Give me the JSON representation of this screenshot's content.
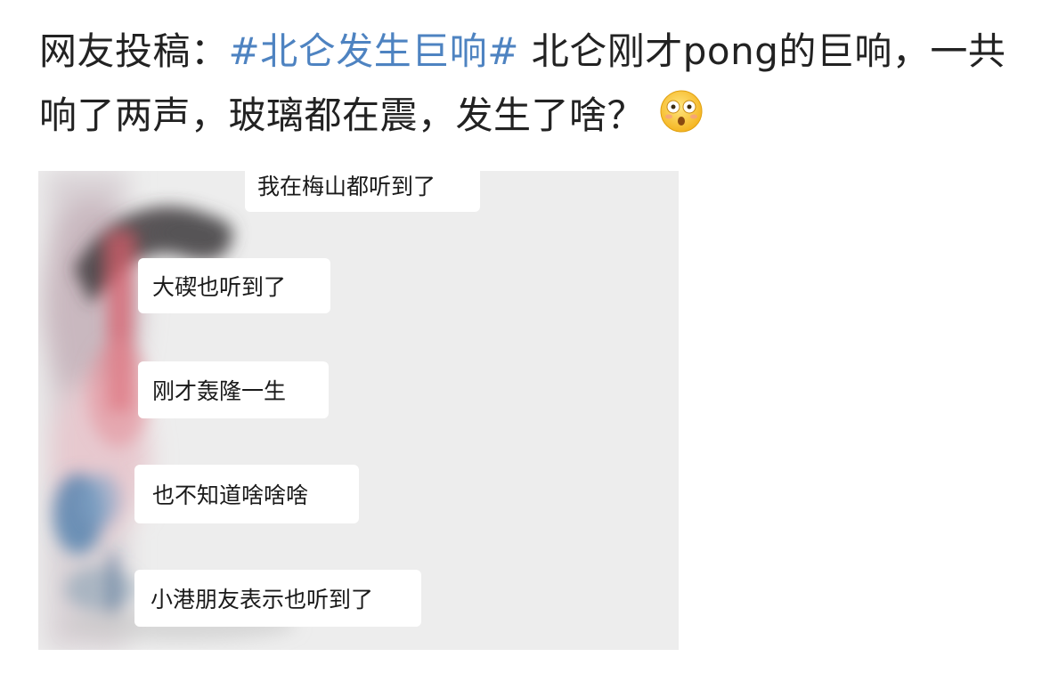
{
  "post": {
    "prefix": "网友投稿：",
    "hashtag": "#北仑发生巨响#",
    "body": " 北仑刚才pong的巨响，一共响了两声，玻璃都在震，发生了啥？",
    "emoji_icon": "shocked-face-emoji"
  },
  "chat": {
    "messages": [
      {
        "text": "我在梅山都听到了"
      },
      {
        "text": "大碶也听到了"
      },
      {
        "text": "刚才轰隆一生"
      },
      {
        "text": "也不知道啥啥啥"
      },
      {
        "text": "小港朋友表示也听到了"
      }
    ]
  },
  "colors": {
    "hashtag": "#4e83c1",
    "text": "#222222",
    "chat_background": "#ededed",
    "bubble": "#ffffff"
  }
}
